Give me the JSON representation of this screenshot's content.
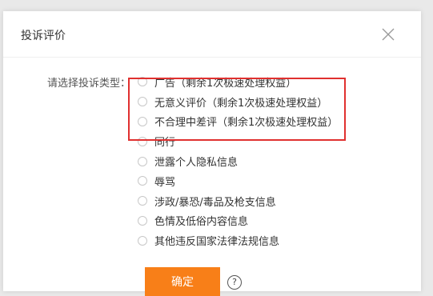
{
  "dialog": {
    "title": "投诉评价",
    "type_label": "请选择投诉类型：",
    "confirm_label": "确定",
    "help_symbol": "?"
  },
  "options": [
    {
      "label": "广告（剩余1次极速处理权益）"
    },
    {
      "label": "无意义评价（剩余1次极速处理权益）"
    },
    {
      "label": "不合理中差评（剩余1次极速处理权益）"
    },
    {
      "label": "同行"
    },
    {
      "label": "泄露个人隐私信息"
    },
    {
      "label": "辱骂"
    },
    {
      "label": "涉政/暴恐/毒品及枪支信息"
    },
    {
      "label": "色情及低俗内容信息"
    },
    {
      "label": "其他违反国家法律法规信息"
    }
  ],
  "colors": {
    "highlight_border": "#e0302f",
    "confirm_button": "#f87f18"
  },
  "icons": {
    "close": "close-icon",
    "help": "help-icon"
  }
}
